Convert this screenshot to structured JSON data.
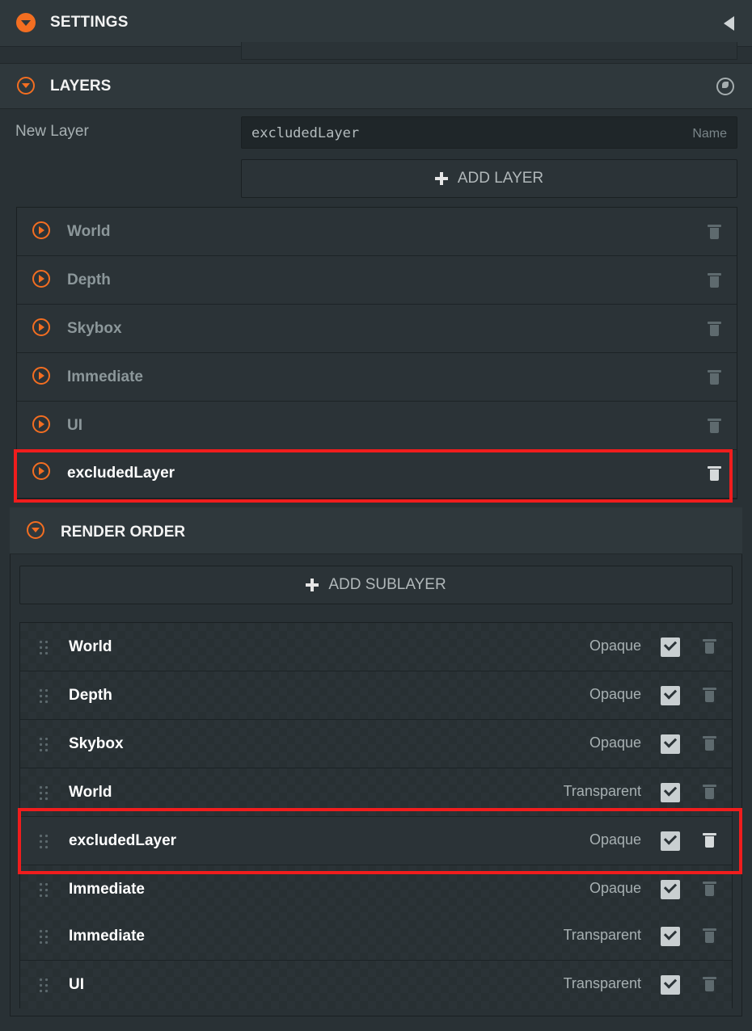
{
  "settings": {
    "title": "SETTINGS"
  },
  "layers": {
    "title": "LAYERS",
    "new_layer_label": "New Layer",
    "new_layer_value": "excludedLayer",
    "new_layer_placeholder": "Name",
    "add_button_label": "ADD LAYER",
    "items": [
      {
        "name": "World"
      },
      {
        "name": "Depth"
      },
      {
        "name": "Skybox"
      },
      {
        "name": "Immediate"
      },
      {
        "name": "UI"
      },
      {
        "name": "excludedLayer"
      }
    ]
  },
  "render_order": {
    "title": "RENDER ORDER",
    "add_button_label": "ADD SUBLAYER",
    "items": [
      {
        "name": "World",
        "mode": "Opaque",
        "enabled": true
      },
      {
        "name": "Depth",
        "mode": "Opaque",
        "enabled": true
      },
      {
        "name": "Skybox",
        "mode": "Opaque",
        "enabled": true
      },
      {
        "name": "World",
        "mode": "Transparent",
        "enabled": true
      },
      {
        "name": "excludedLayer",
        "mode": "Opaque",
        "enabled": true
      },
      {
        "name": "Immediate",
        "mode": "Opaque",
        "enabled": true
      },
      {
        "name": "Immediate",
        "mode": "Transparent",
        "enabled": true
      },
      {
        "name": "UI",
        "mode": "Transparent",
        "enabled": true
      }
    ]
  },
  "colors": {
    "accent": "#f36e21",
    "panel_bg": "#293135",
    "highlight": "#f01d1d"
  }
}
